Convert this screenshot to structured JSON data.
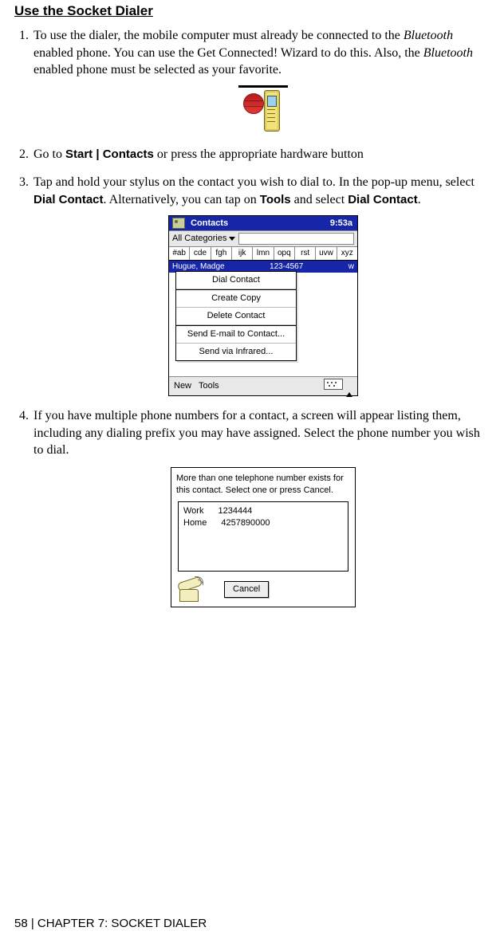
{
  "heading": "Use the Socket Dialer",
  "steps": {
    "s1_a": "To use the dialer, the mobile computer must already be connected to the ",
    "s1_b": "Bluetooth",
    "s1_c": " enabled phone. You can use the Get Connected! Wizard to do this. Also, the ",
    "s1_d": "Bluetooth",
    "s1_e": " enabled phone must be selected as your favorite.",
    "s2_a": "Go to ",
    "s2_b": "Start | Contacts",
    "s2_c": " or press the appropriate hardware button",
    "s3_a": "Tap and hold your stylus on the contact you wish to dial to. In the pop-up menu, select ",
    "s3_b": "Dial Contact",
    "s3_c": ". Alternatively, you can tap on ",
    "s3_d": "Tools",
    "s3_e": " and select ",
    "s3_f": "Dial Contact",
    "s3_g": ".",
    "s4": "If you have multiple phone numbers for a contact, a screen will appear listing them, including any dialing prefix you may have assigned. Select the phone number you wish to dial."
  },
  "win1": {
    "title": "Contacts",
    "clock": "9:53a",
    "categories": "All Categories",
    "alpha": [
      "#ab",
      "cde",
      "fgh",
      "ijk",
      "lmn",
      "opq",
      "rst",
      "uvw",
      "xyz"
    ],
    "contact_name": "Hugue, Madge",
    "contact_num": "123-4567",
    "contact_tag": "w",
    "menu": {
      "dial": "Dial Contact",
      "create": "Create Copy",
      "delete": "Delete Contact",
      "email": "Send E-mail to Contact...",
      "ir": "Send via Infrared..."
    },
    "bottom_new": "New",
    "bottom_tools": "Tools"
  },
  "win2": {
    "msg": "More than one telephone number exists for this contact.  Select one or press Cancel.",
    "rows": [
      {
        "label": "Work",
        "num": "1234444"
      },
      {
        "label": "Home",
        "num": "4257890000"
      }
    ],
    "cancel": "Cancel"
  },
  "footer": {
    "left": "58  | CHAPTER 7: SOCKET DIALER"
  }
}
